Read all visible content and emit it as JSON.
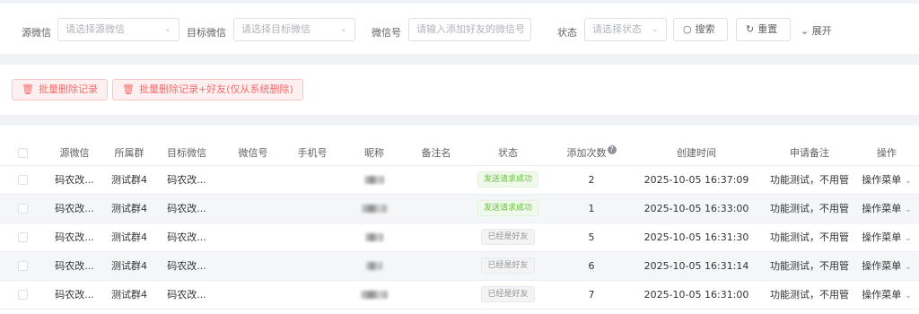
{
  "filters": {
    "source_label": "源微信",
    "source_placeholder": "请选择源微信",
    "target_label": "目标微信",
    "target_placeholder": "请选择目标微信",
    "wechat_label": "微信号",
    "wechat_placeholder": "请输入添加好友的微信号",
    "status_label": "状态",
    "status_placeholder": "请选择状态",
    "search_label": "搜索",
    "reset_label": "重置",
    "expand_label": "展开"
  },
  "actions": {
    "batch_delete_label": "批量删除记录",
    "batch_delete_friend_label": "批量删除记录+好友(仅从系统删除)"
  },
  "table": {
    "columns": [
      "源微信",
      "所属群",
      "目标微信",
      "微信号",
      "手机号",
      "昵称",
      "备注名",
      "状态",
      "添加次数",
      "创建时间",
      "申请备注",
      "操作"
    ],
    "rows": [
      {
        "source": "码农改...",
        "group": "测试群4",
        "target": "码农改...",
        "status": "发送请求成功",
        "status_type": "success",
        "count": "2",
        "created": "2025-10-05 16:37:09",
        "remark": "功能测试，不用管",
        "op": "操作菜单"
      },
      {
        "source": "码农改...",
        "group": "测试群4",
        "target": "码农改...",
        "status": "发送请求成功",
        "status_type": "success",
        "count": "1",
        "created": "2025-10-05 16:33:00",
        "remark": "功能测试，不用管",
        "op": "操作菜单"
      },
      {
        "source": "码农改...",
        "group": "测试群4",
        "target": "码农改...",
        "status": "已经是好友",
        "status_type": "info",
        "count": "5",
        "created": "2025-10-05 16:31:30",
        "remark": "功能测试，不用管",
        "op": "操作菜单"
      },
      {
        "source": "码农改...",
        "group": "测试群4",
        "target": "码农改...",
        "status": "已经是好友",
        "status_type": "info",
        "count": "6",
        "created": "2025-10-05 16:31:14",
        "remark": "功能测试，不用管",
        "op": "操作菜单"
      },
      {
        "source": "码农改...",
        "group": "测试群4",
        "target": "码农改...",
        "status": "已经是好友",
        "status_type": "info",
        "count": "7",
        "created": "2025-10-05 16:31:00",
        "remark": "功能测试，不用管",
        "op": "操作菜单"
      }
    ]
  },
  "icons": {
    "search": "search-icon",
    "reset": "refresh-icon",
    "expand": "chevron-down-icon",
    "delete": "trash-icon",
    "help": "question-icon"
  },
  "colors": {
    "danger": "#f56c6c",
    "success": "#67c23a",
    "info": "#909399"
  }
}
